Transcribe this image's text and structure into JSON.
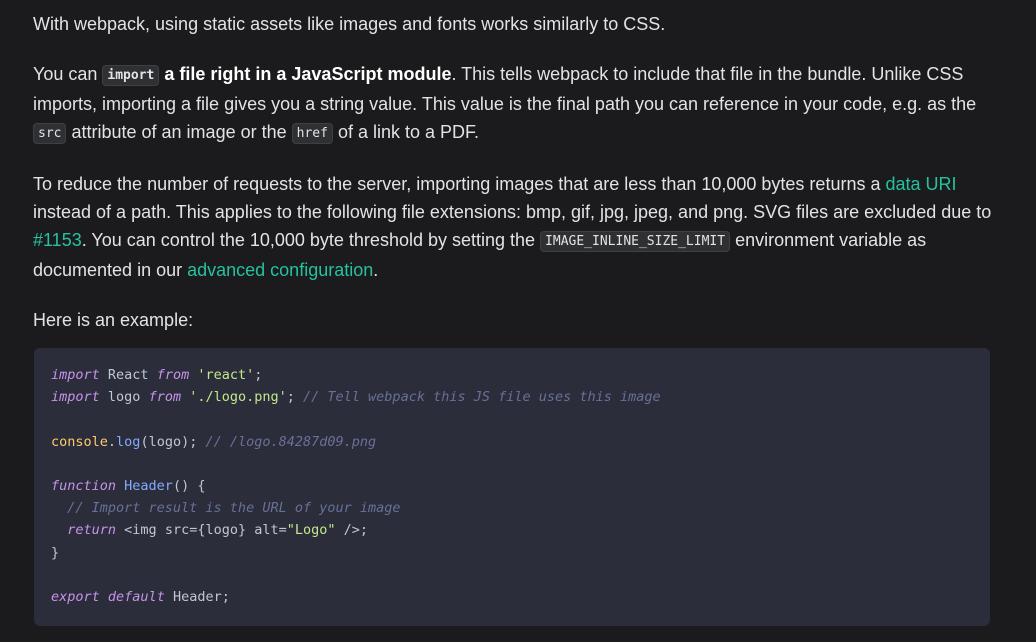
{
  "paragraphs": {
    "intro": "With webpack, using static assets like images and fonts works similarly to CSS.",
    "p2": {
      "t1": "You can ",
      "code1": "import",
      "strong1": " a file right in a JavaScript module",
      "t2": ". This tells webpack to include that file in the bundle. Unlike CSS imports, importing a file gives you a string value. This value is the final path you can reference in your code, e.g. as the ",
      "code2": "src",
      "t3": " attribute of an image or the ",
      "code3": "href",
      "t4": " of a link to a PDF."
    },
    "p3": {
      "t1": "To reduce the number of requests to the server, importing images that are less than 10,000 bytes returns a ",
      "link1": "data URI",
      "t2": " instead of a path. This applies to the following file extensions: bmp, gif, jpg, jpeg, and png. SVG files are excluded due to ",
      "link2": "#1153",
      "t3": ". You can control the 10,000 byte threshold by setting the ",
      "code1": "IMAGE_INLINE_SIZE_LIMIT",
      "t4": " environment variable as documented in our ",
      "link3": "advanced configuration",
      "t5": "."
    },
    "example": "Here is an example:"
  },
  "code": {
    "l1_import": "import",
    "l1_react": " React ",
    "l1_from": "from",
    "l1_str": "'react'",
    "l1_end": ";",
    "l2_import": "import",
    "l2_logo": " logo ",
    "l2_from": "from",
    "l2_str": "'./logo.png'",
    "l2_end": "; ",
    "l2_comment": "// Tell webpack this JS file uses this image",
    "l4_console": "console",
    "l4_dot": ".",
    "l4_log": "log",
    "l4_args": "(logo); ",
    "l4_comment": "// /logo.84287d09.png",
    "l6_function": "function",
    "l6_sp": " ",
    "l6_header": "Header",
    "l6_rest": "() {",
    "l7_comment": "  // Import result is the URL of your image",
    "l8_indent": "  ",
    "l8_return": "return",
    "l8_a": " <img src={logo} alt=",
    "l8_str": "\"Logo\"",
    "l8_b": " />;",
    "l9": "}",
    "l11_export": "export",
    "l11_sp": " ",
    "l11_default": "default",
    "l11_rest": " Header;"
  },
  "colors": {
    "background": "#1b1b1d",
    "link": "#25c2a0",
    "code_bg": "#2b2d3a"
  }
}
